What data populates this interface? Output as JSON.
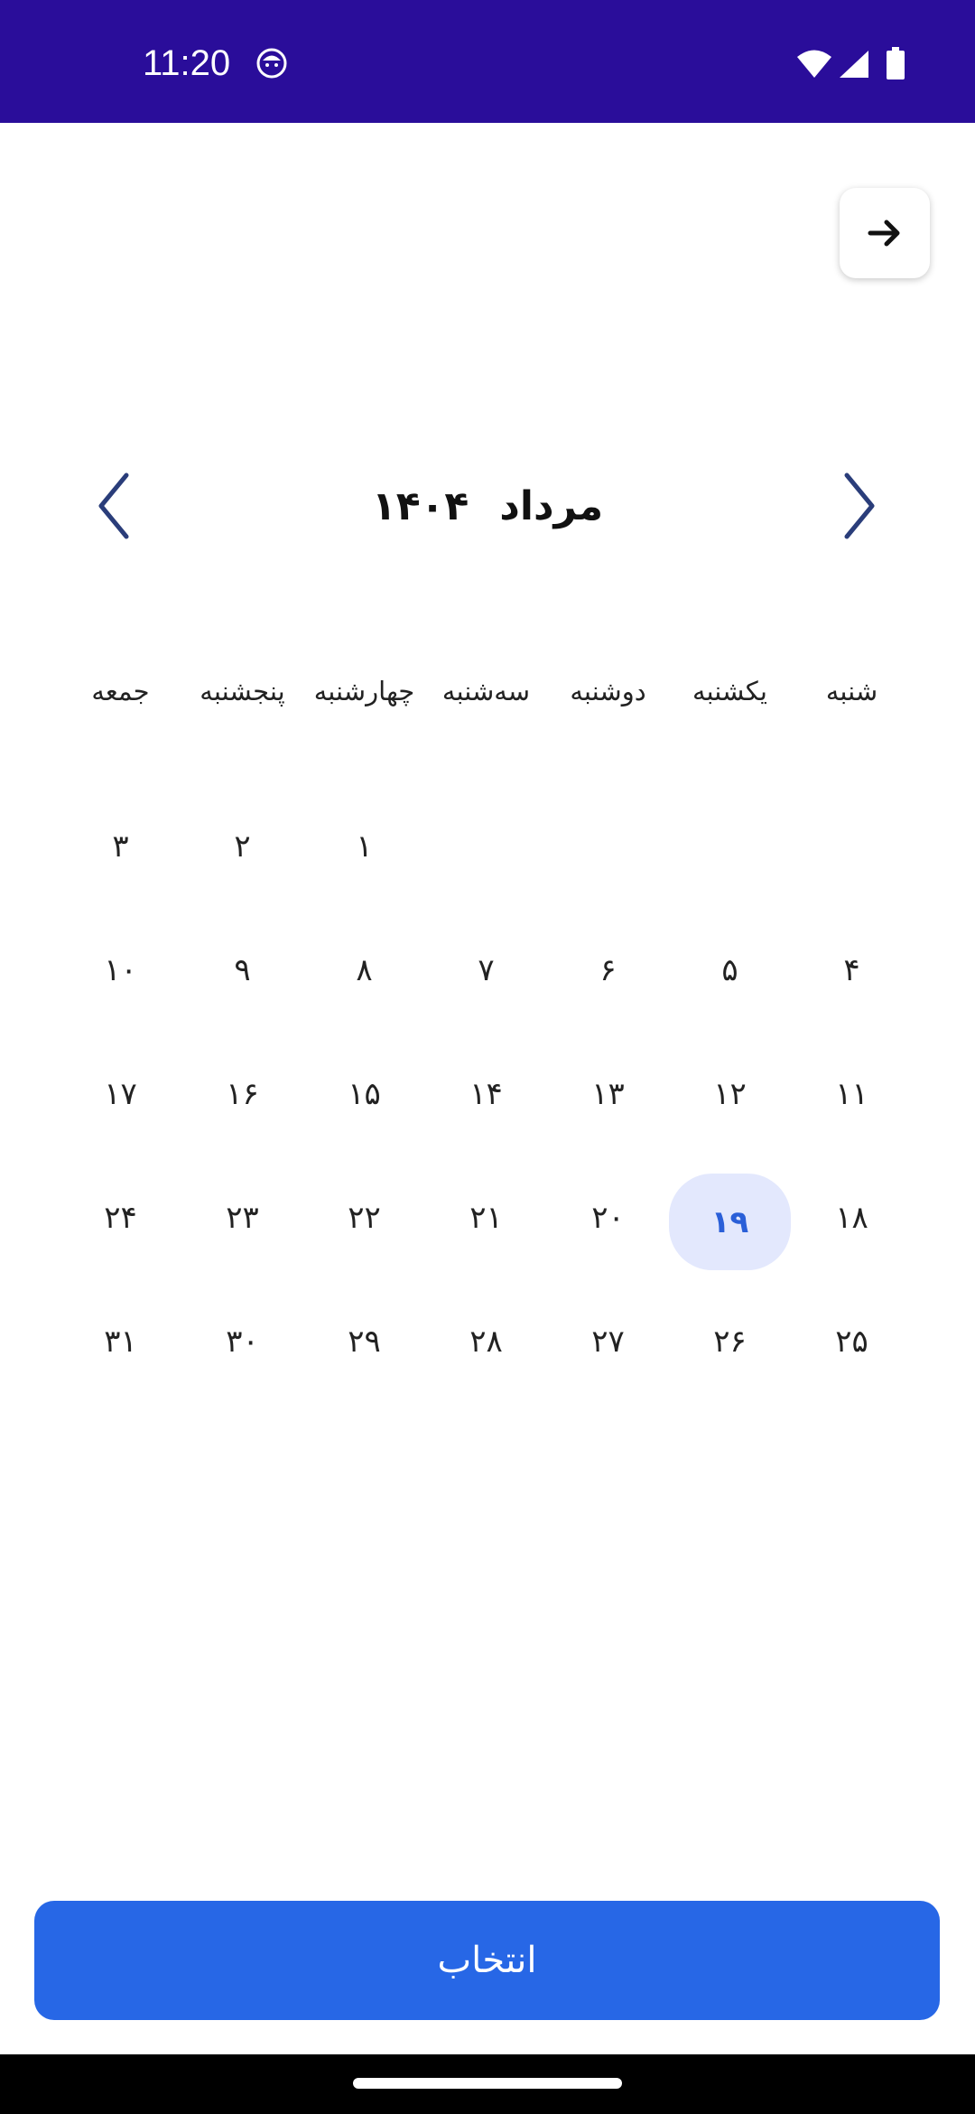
{
  "status_bar": {
    "time": "11:20",
    "icons": [
      "app-notification-icon",
      "wifi-icon",
      "signal-icon",
      "battery-icon"
    ],
    "background": "#2a0d9a"
  },
  "header": {
    "back_icon": "arrow-right-icon"
  },
  "calendar": {
    "month": "مرداد",
    "year": "۱۴۰۴",
    "prev_icon": "chevron-left-icon",
    "next_icon": "chevron-right-icon",
    "weekdays": [
      "شنبه",
      "یکشنبه",
      "دوشنبه",
      "سه‌شنبه",
      "چهارشنبه",
      "پنجشنبه",
      "جمعه"
    ],
    "days": [
      "",
      "",
      "",
      "",
      "۱",
      "۲",
      "۳",
      "۴",
      "۵",
      "۶",
      "۷",
      "۸",
      "۹",
      "۱۰",
      "۱۱",
      "۱۲",
      "۱۳",
      "۱۴",
      "۱۵",
      "۱۶",
      "۱۷",
      "۱۸",
      "۱۹",
      "۲۰",
      "۲۱",
      "۲۲",
      "۲۳",
      "۲۴",
      "۲۵",
      "۲۶",
      "۲۷",
      "۲۸",
      "۲۹",
      "۳۰",
      "۳۱"
    ],
    "selected_day": "۱۹",
    "selected_color": "#2a5fd8",
    "selected_bg": "#e3e8fd"
  },
  "actions": {
    "select_label": "انتخاب",
    "select_color": "#2767e6"
  }
}
